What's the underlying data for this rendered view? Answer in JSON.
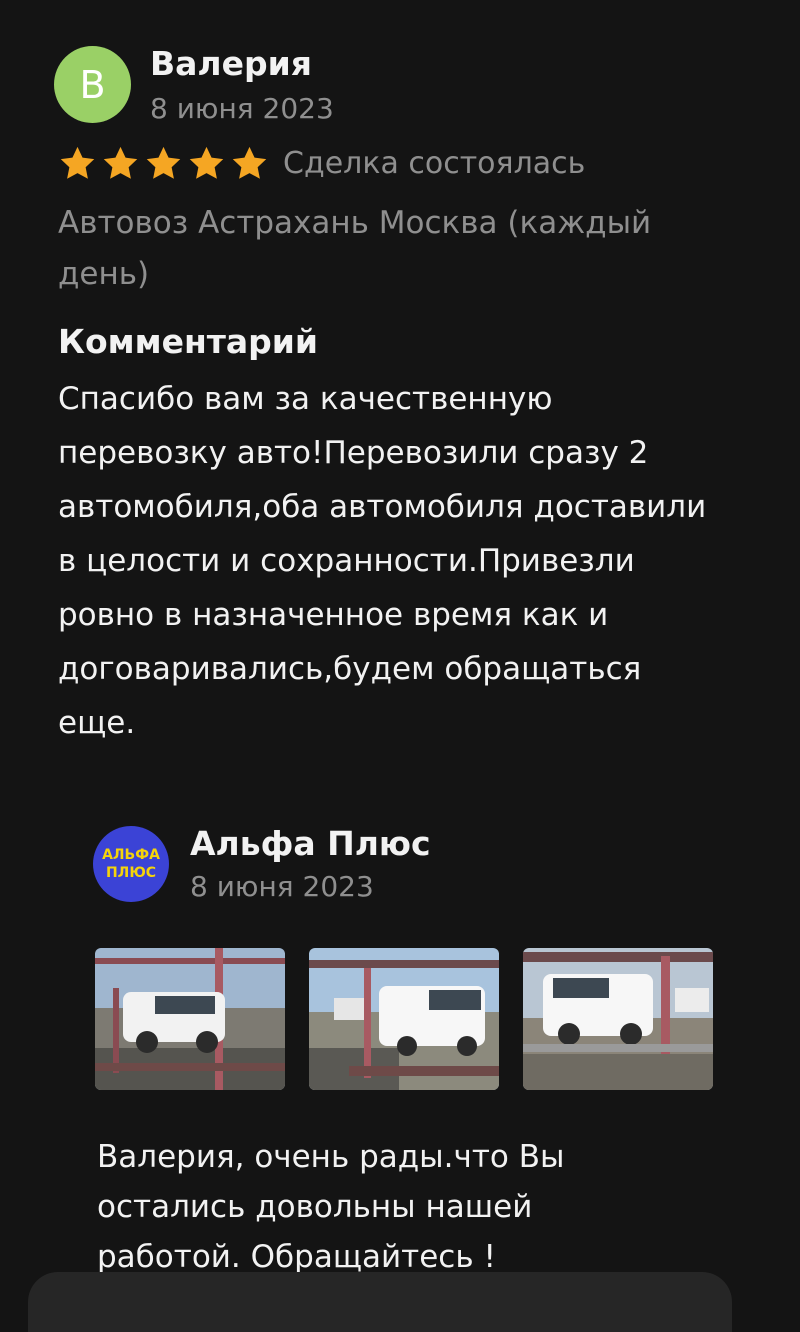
{
  "review": {
    "avatar_letter": "В",
    "author": "Валерия",
    "date": "8 июня 2023",
    "rating": 5,
    "deal_status": "Сделка состоялась",
    "service": "Автовоз Астрахань Москва (каждый день)",
    "comment_heading": "Комментарий",
    "comment": "Спасибо вам за качественную перевозку авто!Перевозили сразу 2 автомобиля,оба автомобиля доставили в целости и сохранности.Привезли ровно в назначенное время как и договаривались,будем обращаться еще."
  },
  "reply": {
    "logo_line1": "АЛЬФА",
    "logo_line2": "ПЛЮС",
    "author": "Альфа Плюс",
    "date": "8 июня 2023",
    "photos": [
      "car-transporter-photo-1",
      "car-transporter-photo-2",
      "car-transporter-photo-3"
    ],
    "text": "Валерия, очень рады.что Вы остались довольны нашей работой. Обращайтесь !"
  },
  "colors": {
    "background": "#141414",
    "star": "#f5a623",
    "avatar": "#9ad066",
    "logo_bg": "#3b43d6",
    "logo_text": "#f5d40a",
    "muted_text": "#8f8f8f"
  }
}
